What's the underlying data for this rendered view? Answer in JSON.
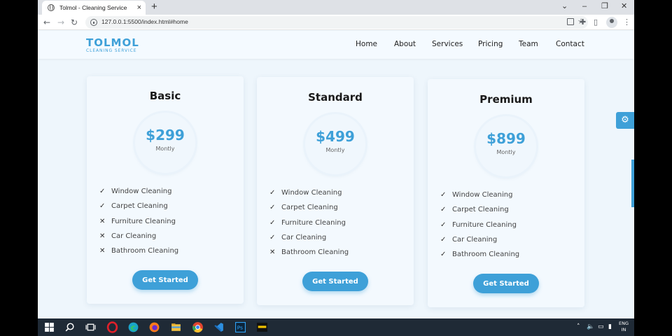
{
  "browser": {
    "tab_title": "Tolmol - Cleaning Service",
    "tab_close": "×",
    "new_tab": "+",
    "url": "127.0.0.1:5500/index.html#home"
  },
  "site": {
    "logo_main": "TOLMOL",
    "logo_sub": "CLEANING SERVICE",
    "nav": [
      "Home",
      "About",
      "Services",
      "Pricing",
      "Team",
      "Contact"
    ]
  },
  "plans": [
    {
      "name": "Basic",
      "price": "$299",
      "period": "Montly",
      "features": [
        {
          "label": "Window Cleaning",
          "included": true
        },
        {
          "label": "Carpet Cleaning",
          "included": true
        },
        {
          "label": "Furniture Cleaning",
          "included": false
        },
        {
          "label": "Car Cleaning",
          "included": false
        },
        {
          "label": "Bathroom Cleaning",
          "included": false
        }
      ],
      "cta": "Get Started"
    },
    {
      "name": "Standard",
      "price": "$499",
      "period": "Montly",
      "features": [
        {
          "label": "Window Cleaning",
          "included": true
        },
        {
          "label": "Carpet Cleaning",
          "included": true
        },
        {
          "label": "Furniture Cleaning",
          "included": true
        },
        {
          "label": "Car Cleaning",
          "included": true
        },
        {
          "label": "Bathroom Cleaning",
          "included": false
        }
      ],
      "cta": "Get Started"
    },
    {
      "name": "Premium",
      "price": "$899",
      "period": "Montly",
      "features": [
        {
          "label": "Window Cleaning",
          "included": true
        },
        {
          "label": "Carpet Cleaning",
          "included": true
        },
        {
          "label": "Furniture Cleaning",
          "included": true
        },
        {
          "label": "Car Cleaning",
          "included": true
        },
        {
          "label": "Bathroom Cleaning",
          "included": true
        }
      ],
      "cta": "Get Started"
    }
  ],
  "taskbar": {
    "lang_line1": "ENG",
    "lang_line2": "IN",
    "icons": [
      "windows-start-icon",
      "search-icon",
      "task-view-icon",
      "opera-icon",
      "edge-icon",
      "firefox-icon",
      "file-explorer-icon",
      "chrome-icon",
      "vscode-icon",
      "photoshop-icon",
      "app-icon"
    ]
  },
  "colors": {
    "accent": "#3ea0d8",
    "page_bg": "#eef6fc",
    "card_bg": "#f3f9fe",
    "taskbar_bg": "#1f2a36"
  }
}
